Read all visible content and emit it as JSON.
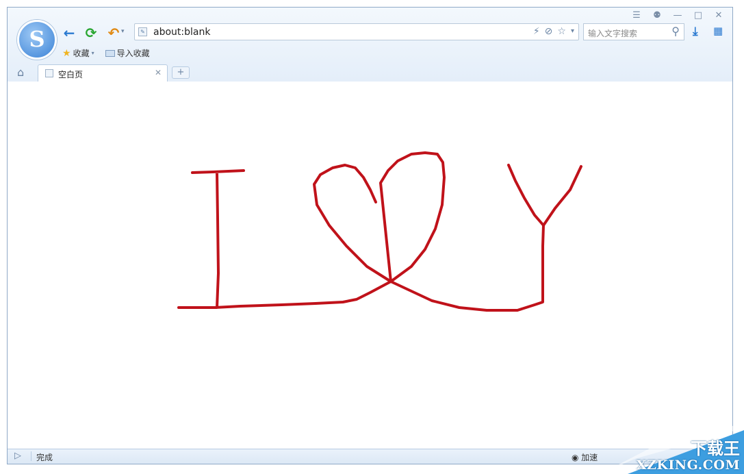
{
  "browser": {
    "logo_letter": "S",
    "window_controls": [
      "menu-icon",
      "skin-icon",
      "minimize-icon",
      "maximize-icon",
      "close-icon"
    ],
    "address": {
      "url": "about:blank"
    },
    "search": {
      "placeholder": "输入文字搜索"
    },
    "bookmarks": [
      {
        "label": "收藏",
        "icon": "star-icon"
      },
      {
        "label": "导入收藏",
        "icon": "folder-icon"
      }
    ],
    "tabs": [
      {
        "label": "空白页"
      }
    ],
    "new_tab_label": "+"
  },
  "status": {
    "text": "完成",
    "accelerate": "加速"
  },
  "drawing": {
    "stroke_color": "#c0121a",
    "strokes": [
      "I",
      "heart",
      "Y"
    ]
  },
  "watermark": {
    "cn": "下载王",
    "en": "XZKING.COM",
    "color": "#3d9ee0"
  }
}
